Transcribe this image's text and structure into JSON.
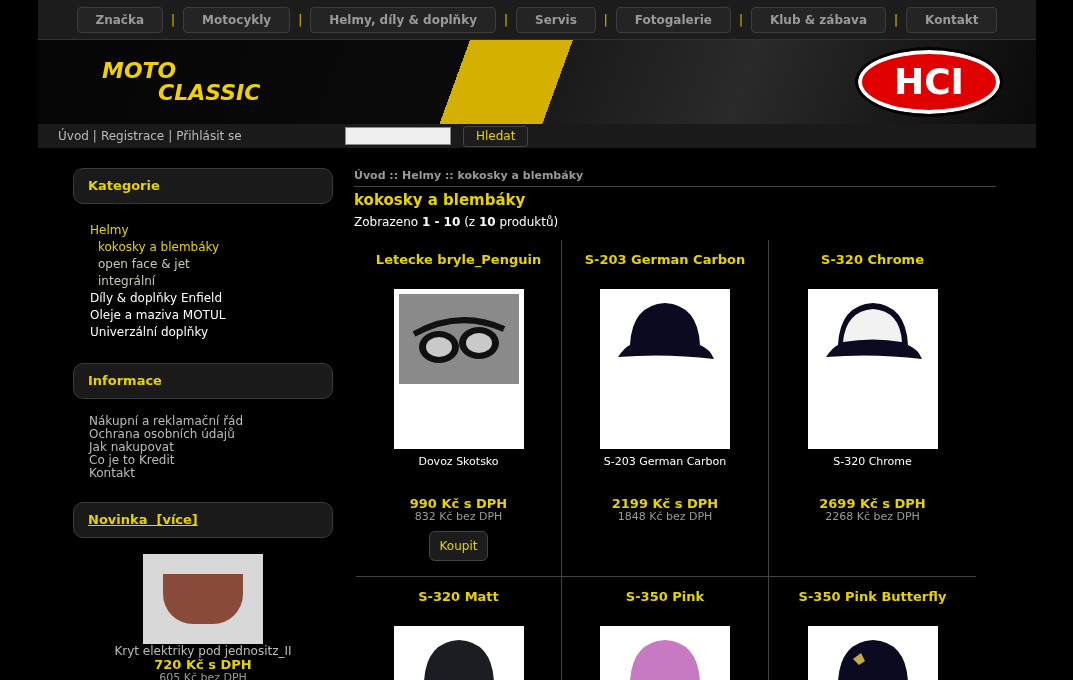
{
  "nav": [
    {
      "label": "Značka"
    },
    {
      "label": "Motocykly"
    },
    {
      "label": "Helmy, díly & doplňky"
    },
    {
      "label": "Servis"
    },
    {
      "label": "Fotogalerie"
    },
    {
      "label": "Klub & zábava"
    },
    {
      "label": "Kontakt"
    }
  ],
  "nav_separator": "|",
  "logo": {
    "line1": "MOTO",
    "line2": "CLASSIC"
  },
  "partner_logo": "HCI",
  "user_links": [
    {
      "label": "Úvod"
    },
    {
      "label": "Registrace"
    },
    {
      "label": "Přihlásit se"
    }
  ],
  "user_links_separator": "|",
  "search": {
    "button": "Hledat"
  },
  "sidebar": {
    "categories_title": "Kategorie",
    "categories": [
      {
        "label": "Helmy",
        "selected": true,
        "children": [
          {
            "label": "kokosky a blembáky",
            "selected": true
          },
          {
            "label": "open face & jet",
            "selected": false
          },
          {
            "label": "integrální",
            "selected": false
          }
        ]
      },
      {
        "label": "Díly & doplňky Enfield",
        "selected": false
      },
      {
        "label": "Oleje a maziva MOTUL",
        "selected": false
      },
      {
        "label": "Univerzální doplňky",
        "selected": false
      }
    ],
    "info_title": "Informace",
    "info_links": [
      "Nákupní a reklamační řád",
      "Ochrana osobních údajů",
      "Jak nakupovat",
      "Co je to Kredit",
      "Kontakt"
    ],
    "news_title": "Novinka  [více]",
    "news": {
      "name": "Kryt elektriky pod jednositz_II",
      "price": "720 Kč s DPH",
      "price_net": "605 Kč bez DPH"
    }
  },
  "breadcrumb": "Úvod :: Helmy :: kokosky a blembáky",
  "heading": "kokosky a blembáky",
  "count": "Zobrazeno **1 - 10** (z **10** produktů)",
  "products": [
    {
      "name": "Letecke bryle_Penguin",
      "kind": "goggles",
      "caption": "Dovoz Skotsko",
      "price": "990 Kč s DPH",
      "price_net": "832 Kč bez DPH",
      "buy": "Koupit"
    },
    {
      "name": "S-203 German Carbon",
      "kind": "helmet-dark",
      "caption": "S-203 German Carbon",
      "price": "2199 Kč s DPH",
      "price_net": "1848 Kč bez DPH"
    },
    {
      "name": "S-320 Chrome",
      "kind": "helmet-chrome",
      "caption": "S-320 Chrome",
      "price": "2699 Kč s DPH",
      "price_net": "2268 Kč bez DPH"
    },
    {
      "name": "S-320 Matt",
      "kind": "helmet-matt"
    },
    {
      "name": "S-350 Pink",
      "kind": "helmet-pink"
    },
    {
      "name": "S-350 Pink Butterfly",
      "kind": "helmet-butterfly"
    }
  ]
}
